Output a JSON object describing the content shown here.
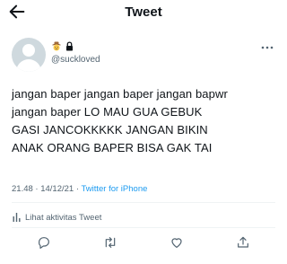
{
  "header": {
    "title": "Tweet"
  },
  "author": {
    "handle": "@suckloved"
  },
  "tweet": {
    "text": "jangan baper jangan baper jangan bapwr\njangan baper LO MAU GUA GEBUK\nGASI JANCOKKKKK JANGAN BIKIN\nANAK ORANG BAPER BISA GAK TAI",
    "timestamp": "21.48 · 14/12/21 · ",
    "source": "Twitter for iPhone"
  },
  "activity": {
    "label": "Lihat aktivitas Tweet"
  },
  "icons": {
    "back": "back-arrow-icon",
    "more": "more-horizontal-icon",
    "reply": "reply-icon",
    "retweet": "retweet-icon",
    "like": "heart-icon",
    "share": "share-icon"
  },
  "colors": {
    "accent": "#1d9bf0",
    "text": "#0f1419",
    "secondary": "#536471"
  }
}
